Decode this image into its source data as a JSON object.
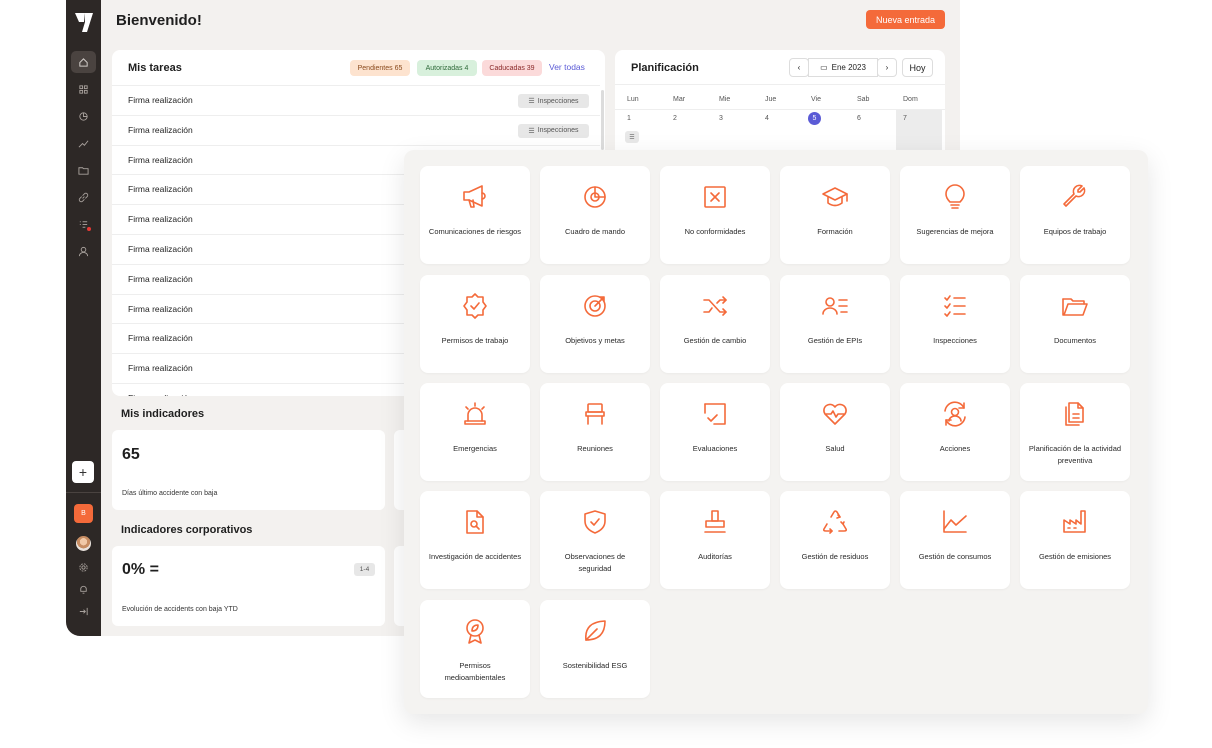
{
  "header": {
    "title": "Bienvenido!",
    "new_entry": "Nueva entrada"
  },
  "sidebar": {
    "icons": [
      "home-icon",
      "grid-icon",
      "pie-icon",
      "trend-icon",
      "folder-icon",
      "link-icon",
      "checklist-icon",
      "user-icon"
    ],
    "add": "+",
    "badge": "B"
  },
  "tasks": {
    "title": "Mis tareas",
    "pending": "Pendientes 65",
    "authorized": "Autorizadas 4",
    "expired": "Caducadas 39",
    "see_all": "Ver todas",
    "rows": [
      {
        "label": "Firma realización",
        "tag": "Inspecciones"
      },
      {
        "label": "Firma realización",
        "tag": "Inspecciones"
      },
      {
        "label": "Firma realización"
      },
      {
        "label": "Firma realización"
      },
      {
        "label": "Firma realización"
      },
      {
        "label": "Firma realización"
      },
      {
        "label": "Firma realización"
      },
      {
        "label": "Firma realización"
      },
      {
        "label": "Firma realización"
      },
      {
        "label": "Firma realización"
      },
      {
        "label": "Firma realización"
      }
    ]
  },
  "planning": {
    "title": "Planificación",
    "month": "Ene 2023",
    "today": "Hoy",
    "weekdays": [
      "Lun",
      "Mar",
      "Mie",
      "Jue",
      "Vie",
      "Sab",
      "Dom"
    ],
    "days": [
      "1",
      "2",
      "3",
      "4",
      "5",
      "6",
      "7"
    ],
    "selected_day": "5"
  },
  "indicators": {
    "title": "Mis indicadores",
    "value": "65",
    "label": "Días último accidente con baja"
  },
  "corporate": {
    "title": "Indicadores corporativos",
    "value": "0% =",
    "range": "1-4",
    "label": "Evolución de accidents con baja YTD"
  },
  "modules": [
    {
      "label": "Comunicaciones de riesgos",
      "icon": "megaphone-icon"
    },
    {
      "label": "Cuadro de mando",
      "icon": "pie-chart-icon"
    },
    {
      "label": "No conformidades",
      "icon": "x-square-icon"
    },
    {
      "label": "Formación",
      "icon": "graduation-cap-icon"
    },
    {
      "label": "Sugerencias de mejora",
      "icon": "lightbulb-icon"
    },
    {
      "label": "Equipos de trabajo",
      "icon": "wrench-icon"
    },
    {
      "label": "Permisos de trabajo",
      "icon": "badge-check-icon"
    },
    {
      "label": "Objetivos y metas",
      "icon": "target-icon"
    },
    {
      "label": "Gestión de cambio",
      "icon": "shuffle-icon"
    },
    {
      "label": "Gestión de EPIs",
      "icon": "user-list-icon"
    },
    {
      "label": "Inspecciones",
      "icon": "checklist-icon"
    },
    {
      "label": "Documentos",
      "icon": "folder-open-icon"
    },
    {
      "label": "Emergencias",
      "icon": "siren-icon"
    },
    {
      "label": "Reuniones",
      "icon": "chair-icon"
    },
    {
      "label": "Evaluaciones",
      "icon": "square-check-icon"
    },
    {
      "label": "Salud",
      "icon": "heart-pulse-icon"
    },
    {
      "label": "Acciones",
      "icon": "user-cycle-icon"
    },
    {
      "label": "Planificación de la actividad preventiva",
      "icon": "files-icon"
    },
    {
      "label": "Investigación de accidentes",
      "icon": "file-search-icon"
    },
    {
      "label": "Observaciones de seguridad",
      "icon": "shield-check-icon"
    },
    {
      "label": "Auditorías",
      "icon": "stamp-icon"
    },
    {
      "label": "Gestión de residuos",
      "icon": "recycle-icon"
    },
    {
      "label": "Gestión de consumos",
      "icon": "line-chart-icon"
    },
    {
      "label": "Gestión de emisiones",
      "icon": "factory-icon"
    },
    {
      "label": "Permisos medioambientales",
      "icon": "award-leaf-icon"
    },
    {
      "label": "Sostenibilidad ESG",
      "icon": "leaf-icon"
    }
  ],
  "colors": {
    "accent": "#f46a3a",
    "sidebar": "#2d2826",
    "today": "#5b5bd6"
  }
}
